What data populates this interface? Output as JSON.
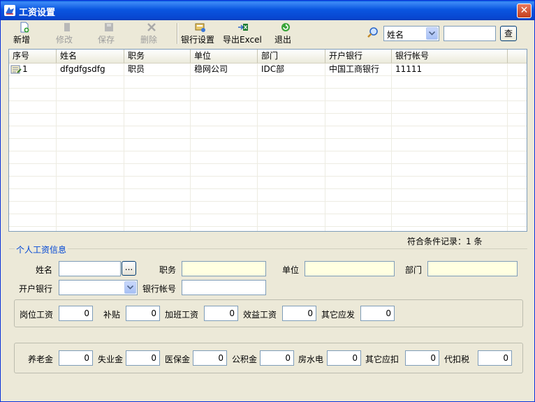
{
  "window": {
    "title": "工资设置",
    "close_glyph": "✕"
  },
  "toolbar": {
    "new_label": "新增",
    "edit_label": "修改",
    "save_label": "保存",
    "delete_label": "删除",
    "bank_settings_label": "银行设置",
    "export_label": "导出Excel",
    "exit_label": "退出"
  },
  "search": {
    "field_selected": "姓名",
    "query_value": "",
    "query_button": "查"
  },
  "grid": {
    "columns": [
      "序号",
      "姓名",
      "职务",
      "单位",
      "部门",
      "开户银行",
      "银行帐号"
    ],
    "rows": [
      [
        "1",
        "dfgdfgsdfg",
        "职员",
        "稳网公司",
        "IDC部",
        "中国工商银行",
        "11111"
      ]
    ]
  },
  "record_count": "符合条件记录：1 条",
  "personal": {
    "title": "个人工资信息",
    "name_label": "姓名",
    "name_value": "",
    "browse_label": "...",
    "position_label": "职务",
    "unit_label": "单位",
    "dept_label": "部门",
    "bank_label": "开户银行",
    "account_label": "银行帐号"
  },
  "income": {
    "base_label": "岗位工资",
    "base_value": "0",
    "allowance_label": "补贴",
    "allowance_value": "0",
    "overtime_label": "加班工资",
    "overtime_value": "0",
    "bonus_label": "效益工资",
    "bonus_value": "0",
    "other_label": "其它应发",
    "other_value": "0"
  },
  "deduction": {
    "pension_label": "养老金",
    "pension_value": "0",
    "unemployment_label": "失业金",
    "unemployment_value": "0",
    "medical_label": "医保金",
    "medical_value": "0",
    "fund_label": "公积金",
    "fund_value": "0",
    "utilities_label": "房水电",
    "utilities_value": "0",
    "other_label": "其它应扣",
    "other_value": "0",
    "tax_label": "代扣税",
    "tax_value": "0"
  }
}
